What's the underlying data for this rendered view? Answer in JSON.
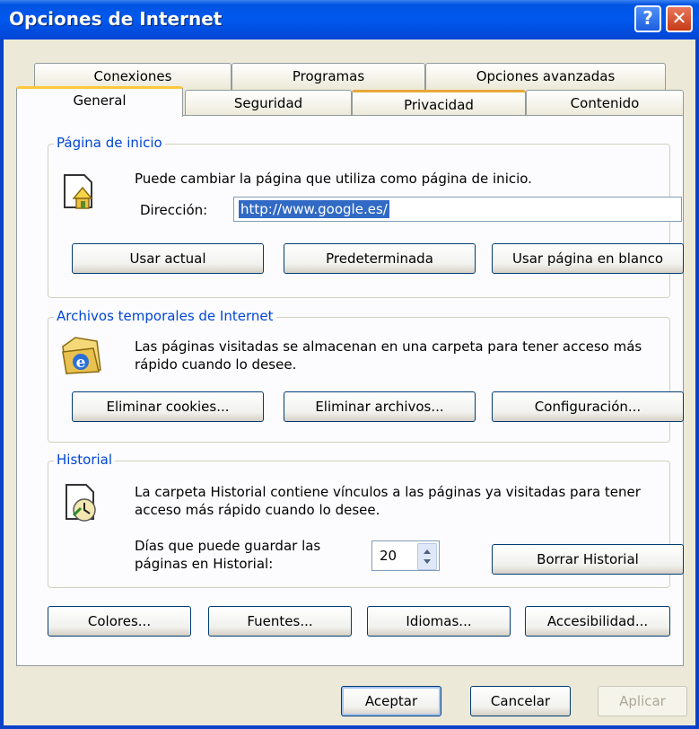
{
  "window": {
    "title": "Opciones de Internet",
    "help_glyph": "?",
    "close_glyph": "✕"
  },
  "tabs_row1": [
    {
      "label": "Conexiones"
    },
    {
      "label": "Programas"
    },
    {
      "label": "Opciones avanzadas"
    }
  ],
  "tabs_row2": [
    {
      "label": "General",
      "selected": true
    },
    {
      "label": "Seguridad"
    },
    {
      "label": "Privacidad"
    },
    {
      "label": "Contenido"
    }
  ],
  "home": {
    "legend": "Página de inicio",
    "description": "Puede cambiar la página que utiliza como página de inicio.",
    "address_label": "Dirección:",
    "address_value": "http://www.google.es/",
    "btn_current": "Usar actual",
    "btn_default": "Predeterminada",
    "btn_blank": "Usar página en blanco"
  },
  "temp": {
    "legend": "Archivos temporales de Internet",
    "description_line1": "Las páginas visitadas se almacenan en una carpeta para tener acceso más",
    "description_line2": "rápido cuando lo desee.",
    "btn_cookies": "Eliminar cookies...",
    "btn_files": "Eliminar archivos...",
    "btn_settings": "Configuración..."
  },
  "history": {
    "legend": "Historial",
    "description_line1": "La carpeta Historial contiene vínculos a las páginas ya visitadas para tener",
    "description_line2": "acceso más rápido cuando lo desee.",
    "days_label_line1": "Días que puede guardar las",
    "days_label_line2": "páginas en Historial:",
    "days_value": "20",
    "btn_clear": "Borrar Historial"
  },
  "bottom_row": {
    "colors": "Colores...",
    "fonts": "Fuentes...",
    "languages": "Idiomas...",
    "accessibility": "Accesibilidad..."
  },
  "dialog": {
    "ok": "Aceptar",
    "cancel": "Cancelar",
    "apply": "Aplicar"
  }
}
